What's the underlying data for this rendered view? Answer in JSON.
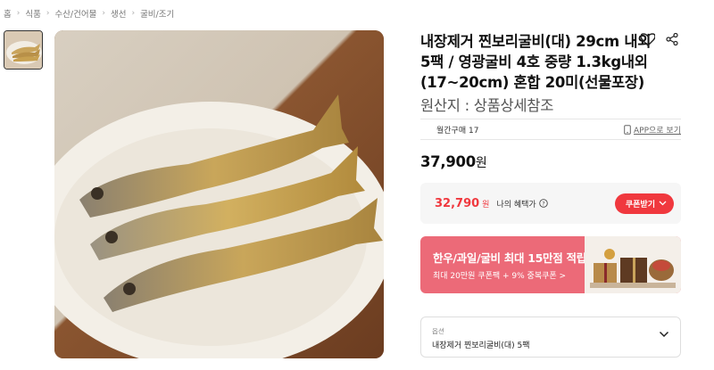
{
  "breadcrumb": [
    "홈",
    "식품",
    "수산/건어물",
    "생선",
    "굴비/조기"
  ],
  "product": {
    "title": "내장제거 찐보리굴비(대) 29cm 내외 5팩 / 영광굴비 4호 중량 1.3kg내외(17~20cm) 혼합 20미(선물포장)",
    "origin": "원산지 : 상품상세참조"
  },
  "info": {
    "monthly_purchase": "월간구매 17",
    "app_link": "APP으로 보기"
  },
  "price": {
    "amount": "37,900",
    "unit": "원"
  },
  "benefit": {
    "price": "32,790",
    "unit": "원",
    "label": "나의 혜택가",
    "coupon_button": "쿠폰받기"
  },
  "banner": {
    "title": "한우/과일/굴비 최대 15만점 적립",
    "subtitle": "최대 20만원 쿠폰팩 + 9% 중복쿠폰 >"
  },
  "option": {
    "label": "옵션",
    "value": "내장제거 찐보리굴비(대) 5팩"
  },
  "colors": {
    "accent_red": "#f0383e",
    "banner_pink": "#ec6a78",
    "text_dark": "#111111"
  },
  "icons": [
    "heart-icon",
    "share-icon",
    "phone-icon",
    "info-icon",
    "chevron-down-icon"
  ]
}
